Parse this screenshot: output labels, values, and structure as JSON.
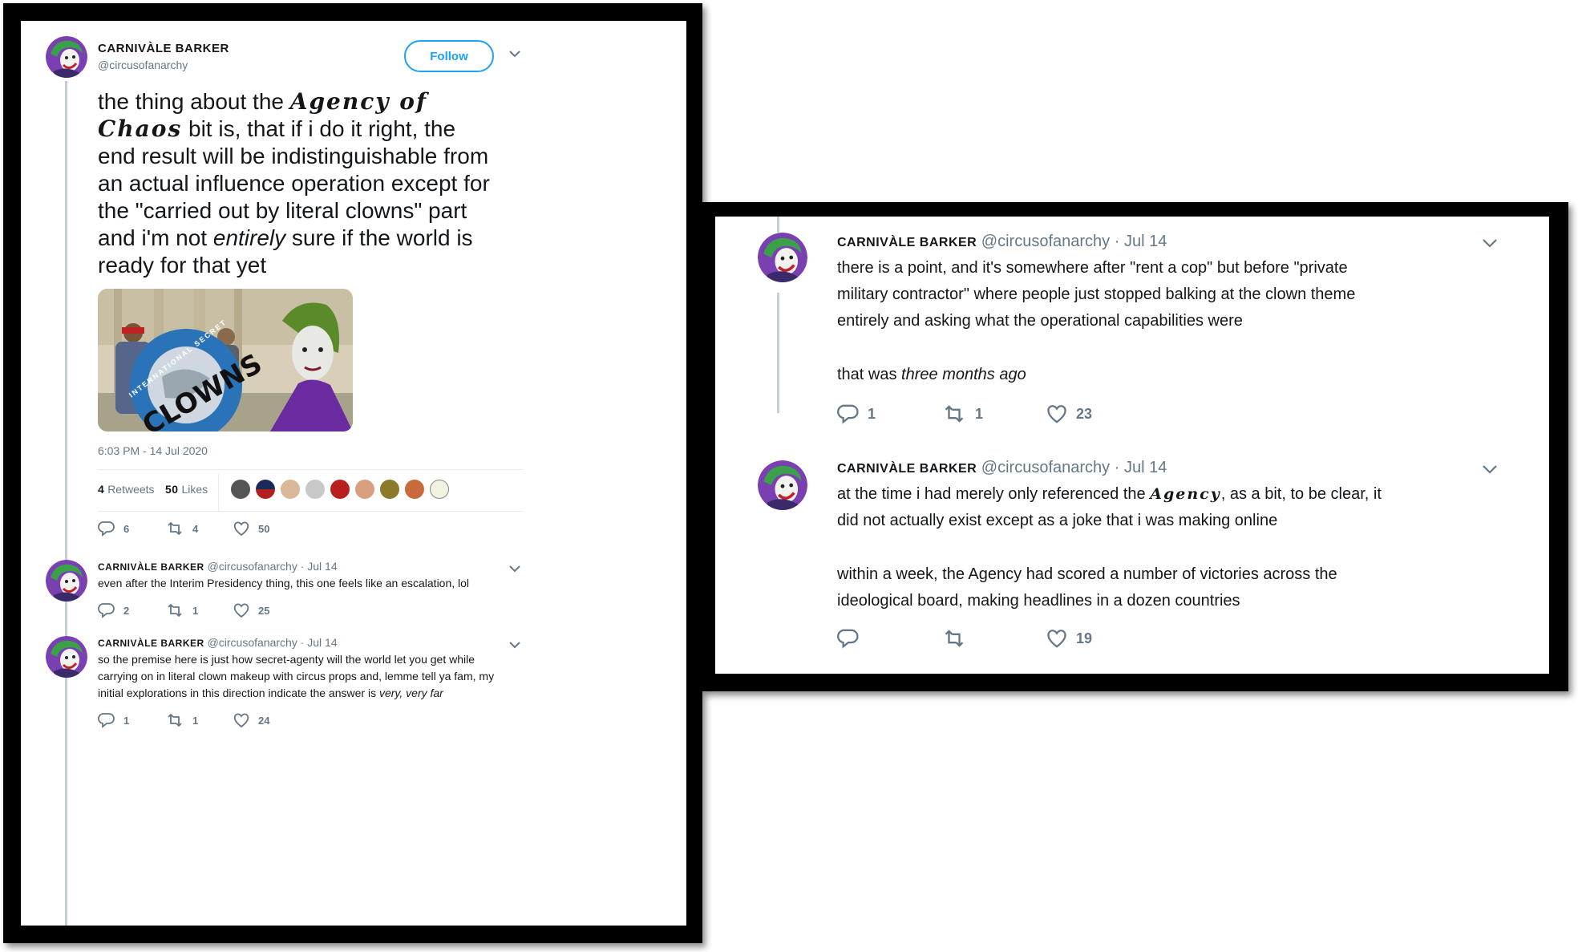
{
  "colors": {
    "link": "#1da1f2",
    "muted": "#657786",
    "text": "#14171a",
    "thread": "#c4cfd6",
    "frame": "#000000"
  },
  "icons": {
    "reply": "reply-icon",
    "retweet": "retweet-icon",
    "like": "heart-icon",
    "caret": "chevron-down-icon"
  },
  "main_tweet": {
    "display_name": "CARNIVÀLE BARKER",
    "handle": "@circusofanarchy",
    "follow_label": "Follow",
    "text_line1_prefix": "the thing about the ",
    "agency_of": "Agency of",
    "chaos": "Chaos",
    "text_line2_suffix": " bit is, that if i do it right, the",
    "text_line3": "end result will be indistinguishable from",
    "text_line4": "an actual influence operation except for",
    "text_line5": "the \"carried out by literal clowns\" part",
    "text_line6_prefix": "and i'm not ",
    "text_line6_em": "entirely",
    "text_line6_suffix": " sure if the world is",
    "text_line7": "ready for that yet",
    "image_text": "CLOWNS",
    "image_ring_text": "INTERNATIONAL SECRET",
    "timestamp": "6:03 PM - 14 Jul 2020",
    "retweet_count": "4",
    "retweet_label": "Retweets",
    "like_count": "50",
    "like_label": "Likes",
    "actions": {
      "reply": "6",
      "retweet": "4",
      "like": "50"
    }
  },
  "left_replies": [
    {
      "display_name": "CARNIVÀLE BARKER",
      "handle": "@circusofanarchy",
      "date": "· Jul 14",
      "text": "even after the Interim Presidency thing, this one feels like an escalation, lol",
      "actions": {
        "reply": "2",
        "retweet": "1",
        "like": "25"
      }
    },
    {
      "display_name": "CARNIVÀLE BARKER",
      "handle": "@circusofanarchy",
      "date": "· Jul 14",
      "line1": "so the premise here is just how secret-agenty will the world let you get while",
      "line2": "carrying on in literal clown makeup with circus props and, lemme tell ya fam, my",
      "line3_prefix": "initial explorations in this direction indicate the answer is ",
      "line3_em": "very, very far",
      "actions": {
        "reply": "1",
        "retweet": "1",
        "like": "24"
      }
    }
  ],
  "right_tweets": [
    {
      "display_name": "CARNIVÀLE BARKER",
      "handle": "@circusofanarchy",
      "date": "· Jul 14",
      "line1": "there is a point, and it's somewhere after \"rent a cop\" but before \"private",
      "line2": "military contractor\" where people just stopped balking at the clown theme",
      "line3": "entirely and asking what the operational capabilities were",
      "line4_prefix": "that was ",
      "line4_em": "three months ago",
      "actions": {
        "reply": "1",
        "retweet": "1",
        "like": "23"
      }
    },
    {
      "display_name": "CARNIVÀLE BARKER",
      "handle": "@circusofanarchy",
      "date": "· Jul 14",
      "line1_prefix": "at the time i had merely only referenced the ",
      "line1_fancy": "Agency",
      "line1_suffix": ", as a bit, to be clear, it",
      "line2": "did not actually exist except as a joke that i was making online",
      "line3": "within a week, the Agency had scored a number of victories across the",
      "line4": "ideological board, making headlines in a dozen countries",
      "actions": {
        "reply": "",
        "retweet": "",
        "like": "19"
      }
    }
  ]
}
